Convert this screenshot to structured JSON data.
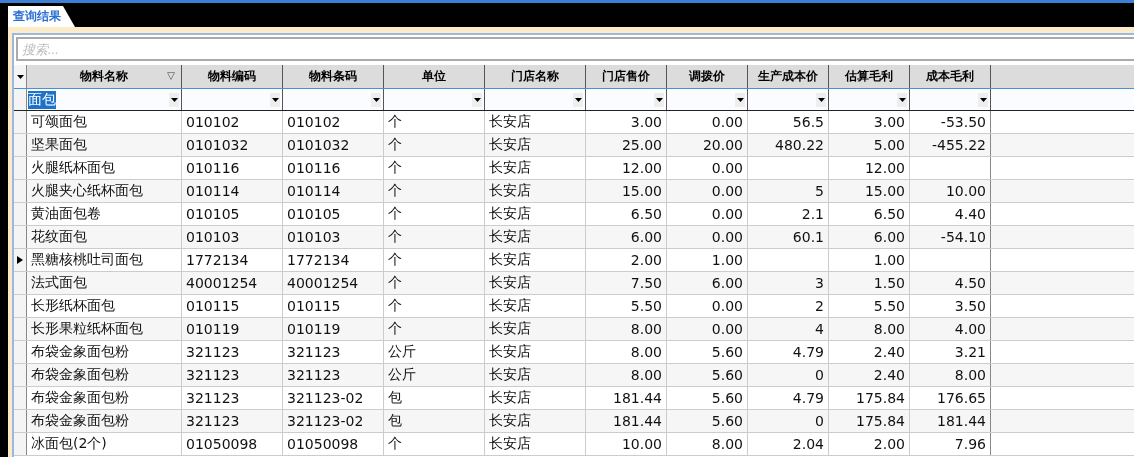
{
  "tab": {
    "label": "查询结果",
    "selected": true
  },
  "search": {
    "placeholder": "搜索..."
  },
  "columns": [
    {
      "label": "物料名称",
      "kind": "text",
      "filtered": true
    },
    {
      "label": "物料编码",
      "kind": "text",
      "filtered": false
    },
    {
      "label": "物料条码",
      "kind": "text",
      "filtered": false
    },
    {
      "label": "单位",
      "kind": "text",
      "filtered": false
    },
    {
      "label": "门店名称",
      "kind": "text",
      "filtered": false
    },
    {
      "label": "门店售价",
      "kind": "number",
      "filtered": false
    },
    {
      "label": "调拨价",
      "kind": "number",
      "filtered": false
    },
    {
      "label": "生产成本价",
      "kind": "number",
      "filtered": false
    },
    {
      "label": "估算毛利",
      "kind": "number",
      "filtered": false
    },
    {
      "label": "成本毛利",
      "kind": "number",
      "filtered": false
    }
  ],
  "name_filter": {
    "value": "面包",
    "selected": true
  },
  "rows": [
    {
      "current": false,
      "cells": [
        "可颂面包",
        "010102",
        "010102",
        "个",
        "长安店",
        "3.00",
        "0.00",
        "56.5",
        "3.00",
        "-53.50"
      ]
    },
    {
      "current": false,
      "cells": [
        "坚果面包",
        "0101032",
        "0101032",
        "个",
        "长安店",
        "25.00",
        "20.00",
        "480.22",
        "5.00",
        "-455.22"
      ]
    },
    {
      "current": false,
      "cells": [
        "火腿纸杯面包",
        "010116",
        "010116",
        "个",
        "长安店",
        "12.00",
        "0.00",
        null,
        "12.00",
        null
      ]
    },
    {
      "current": false,
      "cells": [
        "火腿夹心纸杯面包",
        "010114",
        "010114",
        "个",
        "长安店",
        "15.00",
        "0.00",
        "5",
        "15.00",
        "10.00"
      ]
    },
    {
      "current": false,
      "cells": [
        "黄油面包卷",
        "010105",
        "010105",
        "个",
        "长安店",
        "6.50",
        "0.00",
        "2.1",
        "6.50",
        "4.40"
      ]
    },
    {
      "current": false,
      "cells": [
        "花纹面包",
        "010103",
        "010103",
        "个",
        "长安店",
        "6.00",
        "0.00",
        "60.1",
        "6.00",
        "-54.10"
      ]
    },
    {
      "current": true,
      "cells": [
        "黑糖核桃吐司面包",
        "1772134",
        "1772134",
        "个",
        "长安店",
        "2.00",
        "1.00",
        null,
        "1.00",
        null
      ]
    },
    {
      "current": false,
      "cells": [
        "法式面包",
        "40001254",
        "40001254",
        "个",
        "长安店",
        "7.50",
        "6.00",
        "3",
        "1.50",
        "4.50"
      ]
    },
    {
      "current": false,
      "cells": [
        "长形纸杯面包",
        "010115",
        "010115",
        "个",
        "长安店",
        "5.50",
        "0.00",
        "2",
        "5.50",
        "3.50"
      ]
    },
    {
      "current": false,
      "cells": [
        "长形果粒纸杯面包",
        "010119",
        "010119",
        "个",
        "长安店",
        "8.00",
        "0.00",
        "4",
        "8.00",
        "4.00"
      ]
    },
    {
      "current": false,
      "cells": [
        "布袋金象面包粉",
        "321123",
        "321123",
        "公斤",
        "长安店",
        "8.00",
        "5.60",
        "4.79",
        "2.40",
        "3.21"
      ]
    },
    {
      "current": false,
      "cells": [
        "布袋金象面包粉",
        "321123",
        "321123",
        "公斤",
        "长安店",
        "8.00",
        "5.60",
        "0",
        "2.40",
        "8.00"
      ]
    },
    {
      "current": false,
      "cells": [
        "布袋金象面包粉",
        "321123",
        "321123-02",
        "包",
        "长安店",
        "181.44",
        "5.60",
        "4.79",
        "175.84",
        "176.65"
      ]
    },
    {
      "current": false,
      "cells": [
        "布袋金象面包粉",
        "321123",
        "321123-02",
        "包",
        "长安店",
        "181.44",
        "5.60",
        "0",
        "175.84",
        "181.44"
      ]
    },
    {
      "current": false,
      "cells": [
        "冰面包(2个)",
        "01050098",
        "01050098",
        "个",
        "长安店",
        "10.00",
        "8.00",
        "2.04",
        "2.00",
        "7.96"
      ]
    }
  ]
}
